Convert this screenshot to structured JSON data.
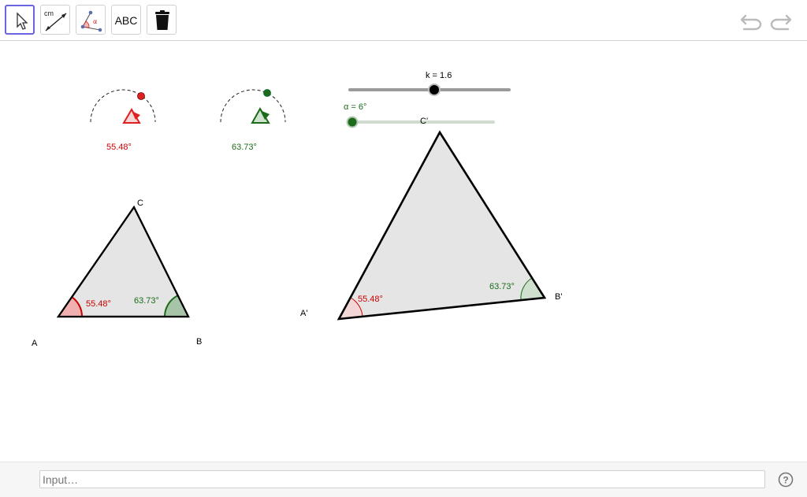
{
  "toolbar": {
    "tools": [
      {
        "name": "move",
        "label": ""
      },
      {
        "name": "segment",
        "label": "cm"
      },
      {
        "name": "angle",
        "label": "α"
      },
      {
        "name": "text",
        "label": "ABC"
      },
      {
        "name": "delete",
        "label": ""
      }
    ]
  },
  "sliders": {
    "k": {
      "label": "k = 1.6",
      "value": 1.6,
      "color": "#000000"
    },
    "alpha": {
      "label": "α = 6°",
      "value": 6,
      "color": "#1a6b1a"
    }
  },
  "angle_markers": {
    "red": {
      "label": "55.48°",
      "color": "#cc0000"
    },
    "green": {
      "label": "63.73°",
      "color": "#1a6b1a"
    }
  },
  "triangle_original": {
    "A": "A",
    "B": "B",
    "C": "C",
    "angle_A": "55.48°",
    "angle_B": "63.73°"
  },
  "triangle_image": {
    "A": "A'",
    "B": "B'",
    "C": "C'",
    "angle_A": "55.48°",
    "angle_B": "63.73°"
  },
  "input": {
    "placeholder": "Input…"
  },
  "help": {
    "label": "?"
  },
  "colors": {
    "accent": "#6b63e0",
    "red": "#cc0000",
    "green": "#1a6b1a",
    "fill": "#e5e5e5"
  }
}
